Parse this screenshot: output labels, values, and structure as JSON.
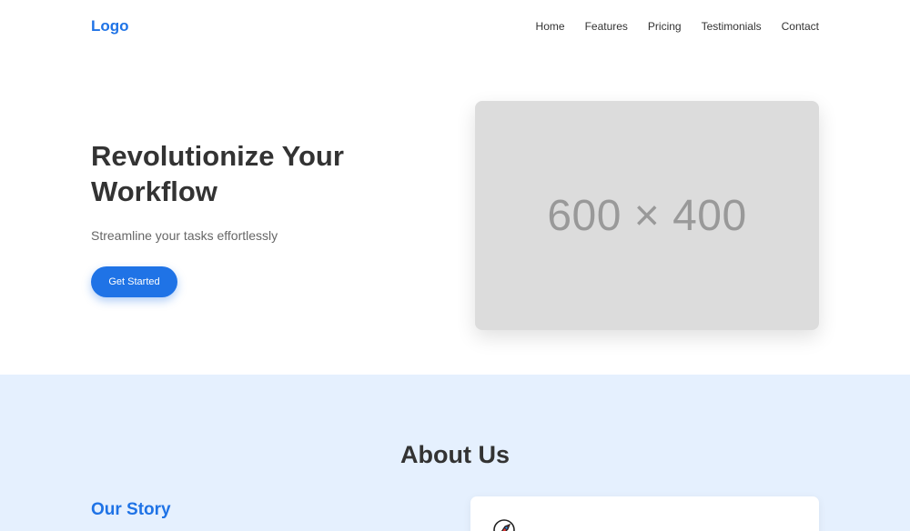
{
  "header": {
    "logo": "Logo",
    "nav": [
      "Home",
      "Features",
      "Pricing",
      "Testimonials",
      "Contact"
    ]
  },
  "hero": {
    "title": "Revolutionize Your Workflow",
    "subtitle": "Streamline your tasks effortlessly",
    "cta_label": "Get Started",
    "image_placeholder": "600 × 400"
  },
  "about": {
    "title": "About Us",
    "story_title": "Our Story",
    "card_icon": "rocket-icon"
  },
  "colors": {
    "accent": "#1f73e6",
    "about_bg": "#e5f0fe",
    "placeholder_bg": "#dcdcdc",
    "text": "#333333"
  }
}
